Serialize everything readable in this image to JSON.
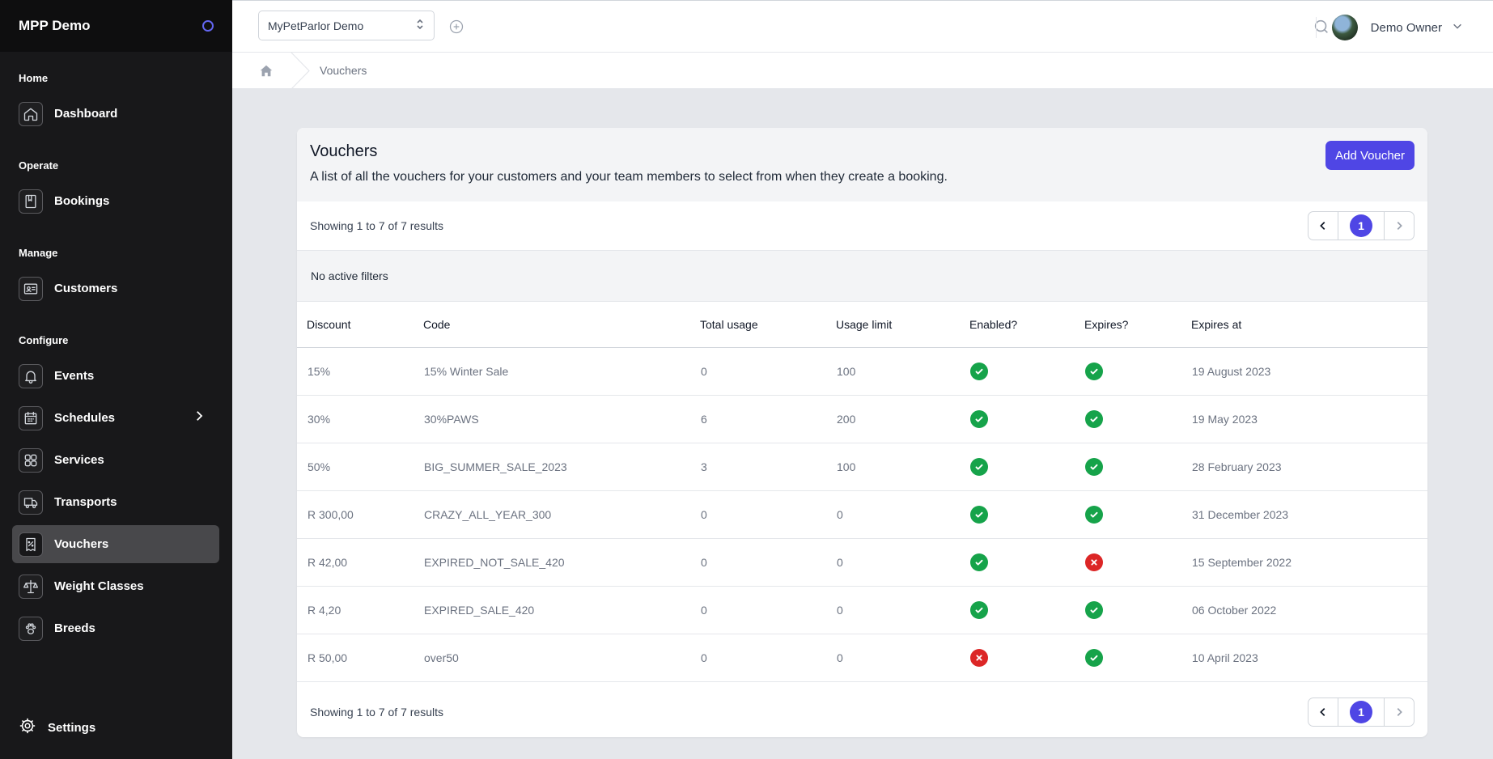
{
  "app": {
    "name": "MPP Demo"
  },
  "sidebar": {
    "sections": [
      {
        "label": "Home"
      },
      {
        "label": "Operate"
      },
      {
        "label": "Manage"
      },
      {
        "label": "Configure"
      }
    ],
    "items": [
      {
        "label": "Dashboard",
        "icon": "home-icon"
      },
      {
        "label": "Bookings",
        "icon": "book-icon"
      },
      {
        "label": "Customers",
        "icon": "id-card-icon"
      },
      {
        "label": "Events",
        "icon": "bell-icon"
      },
      {
        "label": "Schedules",
        "icon": "calendar-icon"
      },
      {
        "label": "Services",
        "icon": "grid-icon"
      },
      {
        "label": "Transports",
        "icon": "truck-icon"
      },
      {
        "label": "Vouchers",
        "icon": "voucher-icon",
        "active": true
      },
      {
        "label": "Weight Classes",
        "icon": "scale-icon"
      },
      {
        "label": "Breeds",
        "icon": "paw-icon"
      }
    ],
    "settings_label": "Settings"
  },
  "topbar": {
    "org_select": "MyPetParlor Demo",
    "user_name": "Demo Owner"
  },
  "breadcrumb": {
    "current": "Vouchers"
  },
  "page": {
    "title": "Vouchers",
    "description": "A list of all the vouchers for your customers and your team members to select from when they create a booking.",
    "add_button": "Add Voucher",
    "results_text": "Showing 1 to 7 of 7 results",
    "current_page": "1",
    "filters_text": "No active filters"
  },
  "table": {
    "columns": [
      "Discount",
      "Code",
      "Total usage",
      "Usage limit",
      "Enabled?",
      "Expires?",
      "Expires at"
    ],
    "rows": [
      {
        "discount": "15%",
        "code": "15% Winter Sale",
        "total_usage": "0",
        "usage_limit": "100",
        "enabled": true,
        "expires": true,
        "expires_at": "19 August 2023"
      },
      {
        "discount": "30%",
        "code": "30%PAWS",
        "total_usage": "6",
        "usage_limit": "200",
        "enabled": true,
        "expires": true,
        "expires_at": "19 May 2023"
      },
      {
        "discount": "50%",
        "code": "BIG_SUMMER_SALE_2023",
        "total_usage": "3",
        "usage_limit": "100",
        "enabled": true,
        "expires": true,
        "expires_at": "28 February 2023"
      },
      {
        "discount": "R 300,00",
        "code": "CRAZY_ALL_YEAR_300",
        "total_usage": "0",
        "usage_limit": "0",
        "enabled": true,
        "expires": true,
        "expires_at": "31 December 2023"
      },
      {
        "discount": "R 42,00",
        "code": "EXPIRED_NOT_SALE_420",
        "total_usage": "0",
        "usage_limit": "0",
        "enabled": true,
        "expires": false,
        "expires_at": "15 September 2022"
      },
      {
        "discount": "R 4,20",
        "code": "EXPIRED_SALE_420",
        "total_usage": "0",
        "usage_limit": "0",
        "enabled": true,
        "expires": true,
        "expires_at": "06 October 2022"
      },
      {
        "discount": "R 50,00",
        "code": "over50",
        "total_usage": "0",
        "usage_limit": "0",
        "enabled": false,
        "expires": true,
        "expires_at": "10 April 2023"
      }
    ]
  },
  "colors": {
    "accent": "#4f46e5",
    "success": "#16a34a",
    "danger": "#dc2626",
    "sidebar_bg": "#18181a"
  }
}
